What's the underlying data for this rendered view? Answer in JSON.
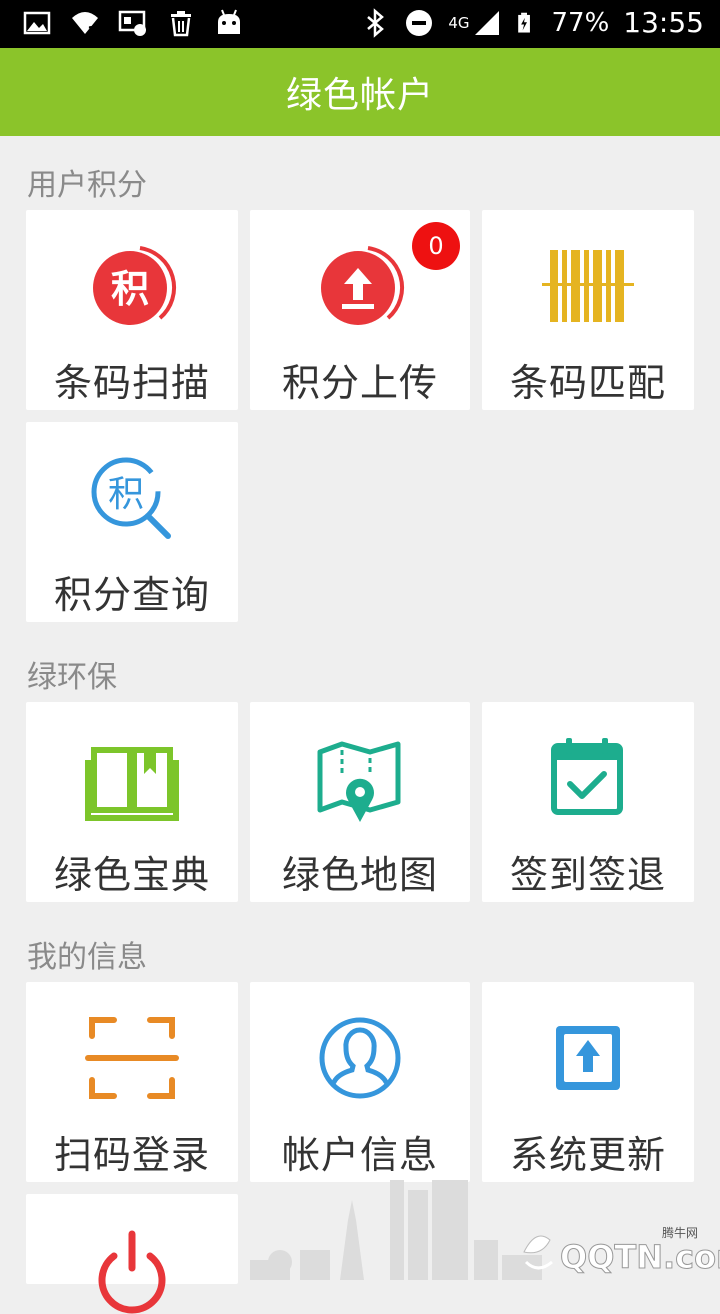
{
  "status_bar": {
    "battery": "77%",
    "time": "13:55",
    "network": "4G"
  },
  "header": {
    "title": "绿色帐户"
  },
  "sections": [
    {
      "title": "用户积分",
      "tiles": [
        {
          "label": "条码扫描",
          "icon": "points-scan-icon"
        },
        {
          "label": "积分上传",
          "icon": "upload-icon",
          "badge": "0"
        },
        {
          "label": "条码匹配",
          "icon": "barcode-icon"
        },
        {
          "label": "积分查询",
          "icon": "points-search-icon"
        }
      ]
    },
    {
      "title": "绿环保",
      "tiles": [
        {
          "label": "绿色宝典",
          "icon": "book-icon"
        },
        {
          "label": "绿色地图",
          "icon": "map-icon"
        },
        {
          "label": "签到签退",
          "icon": "calendar-check-icon"
        }
      ]
    },
    {
      "title": "我的信息",
      "tiles": [
        {
          "label": "扫码登录",
          "icon": "scan-frame-icon"
        },
        {
          "label": "帐户信息",
          "icon": "user-icon"
        },
        {
          "label": "系统更新",
          "icon": "update-icon"
        },
        {
          "label": "",
          "icon": "power-icon"
        }
      ]
    }
  ],
  "watermark": {
    "brand": "腾牛网",
    "text": "QQTN.com"
  },
  "colors": {
    "header": "#8bc42a",
    "red": "#e8363a",
    "gold": "#e5b421",
    "blue": "#3596dc",
    "green": "#7cc52a",
    "teal": "#1dad8e",
    "orange": "#e88a25",
    "badge": "#ee1111"
  }
}
